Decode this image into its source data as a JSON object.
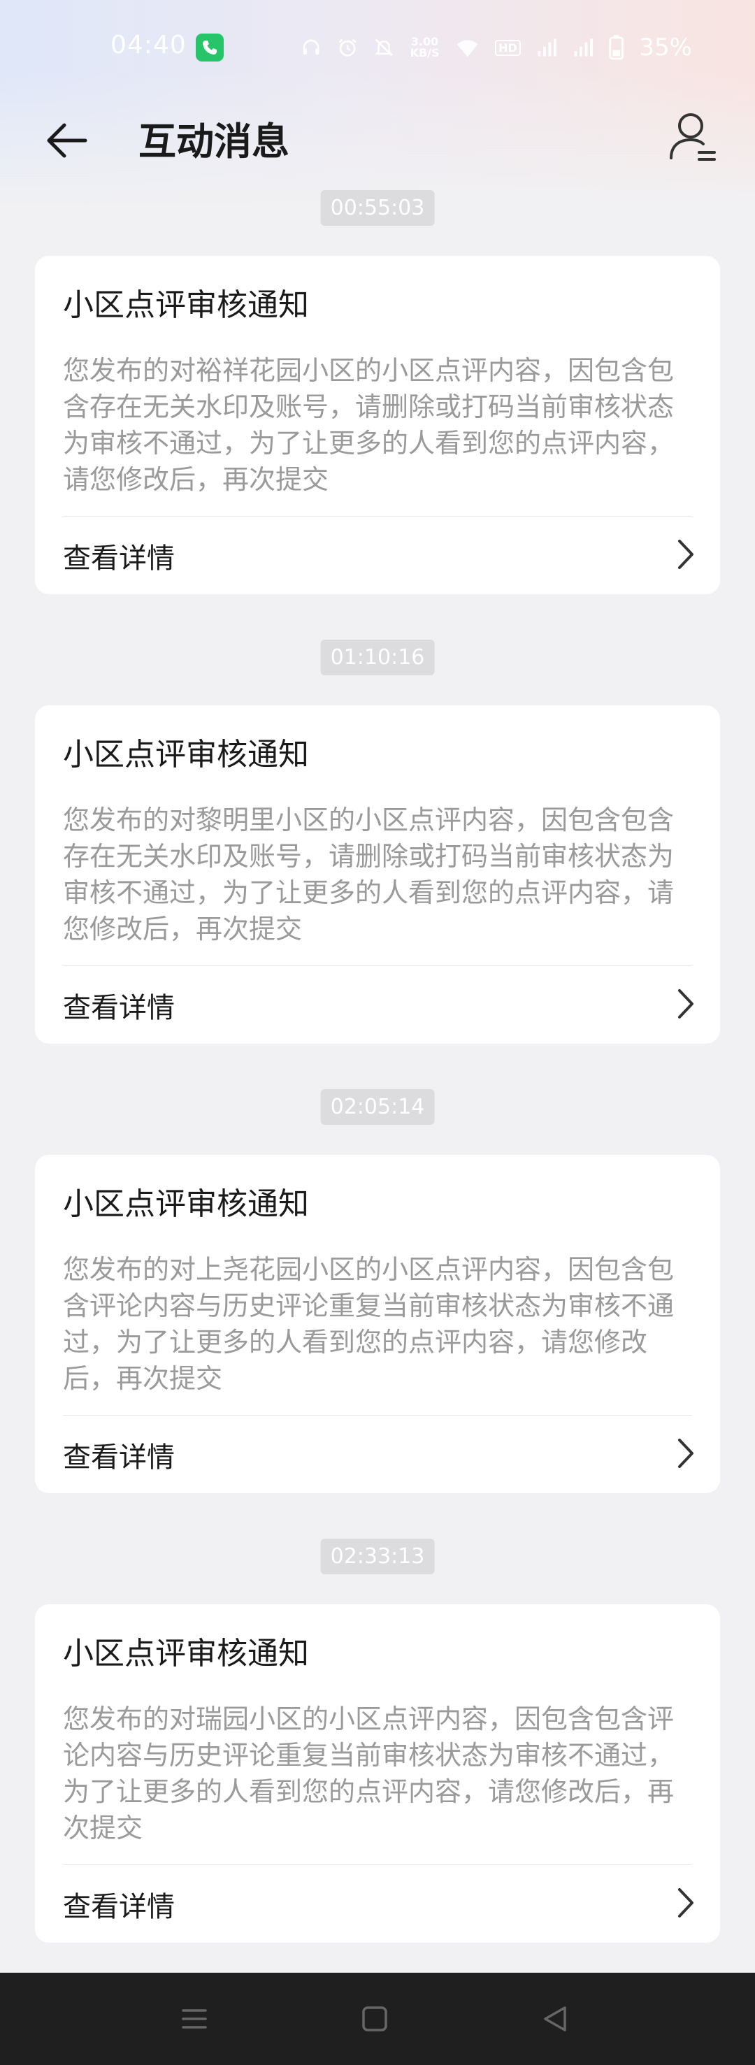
{
  "status_bar": {
    "time": "04:40",
    "speed_value": "3.00",
    "speed_unit": "KB/S",
    "hd_label": "HD",
    "battery_percent": "35%",
    "call_color": "#28c46a",
    "icons": [
      "headphones-icon",
      "alarm-icon",
      "mute-icon",
      "network-speed",
      "wifi-icon",
      "hd-voice-icon",
      "signal-icon",
      "signal-icon",
      "battery-icon"
    ]
  },
  "header": {
    "title": "互动消息",
    "back_icon": "arrow-left-icon",
    "profile_icon": "user-list-icon"
  },
  "messages": [
    {
      "time": "00:55:03",
      "title": "小区点评审核通知",
      "body": "您发布的对裕祥花园小区的小区点评内容，因包含包含存在无关水印及账号，请删除或打码当前审核状态为审核不通过，为了让更多的人看到您的点评内容，请您修改后，再次提交",
      "link": "查看详情"
    },
    {
      "time": "01:10:16",
      "title": "小区点评审核通知",
      "body": "您发布的对黎明里小区的小区点评内容，因包含包含存在无关水印及账号，请删除或打码当前审核状态为审核不通过，为了让更多的人看到您的点评内容，请您修改后，再次提交",
      "link": "查看详情"
    },
    {
      "time": "02:05:14",
      "title": "小区点评审核通知",
      "body": "您发布的对上尧花园小区的小区点评内容，因包含包含评论内容与历史评论重复当前审核状态为审核不通过，为了让更多的人看到您的点评内容，请您修改后，再次提交",
      "link": "查看详情"
    },
    {
      "time": "02:33:13",
      "title": "小区点评审核通知",
      "body": "您发布的对瑞园小区的小区点评内容，因包含包含评论内容与历史评论重复当前审核状态为审核不通过，为了让更多的人看到您的点评内容，请您修改后，再次提交",
      "link": "查看详情"
    }
  ],
  "nav_bar": {
    "icons": [
      "menu-icon",
      "home-icon",
      "back-triangle-icon"
    ]
  }
}
